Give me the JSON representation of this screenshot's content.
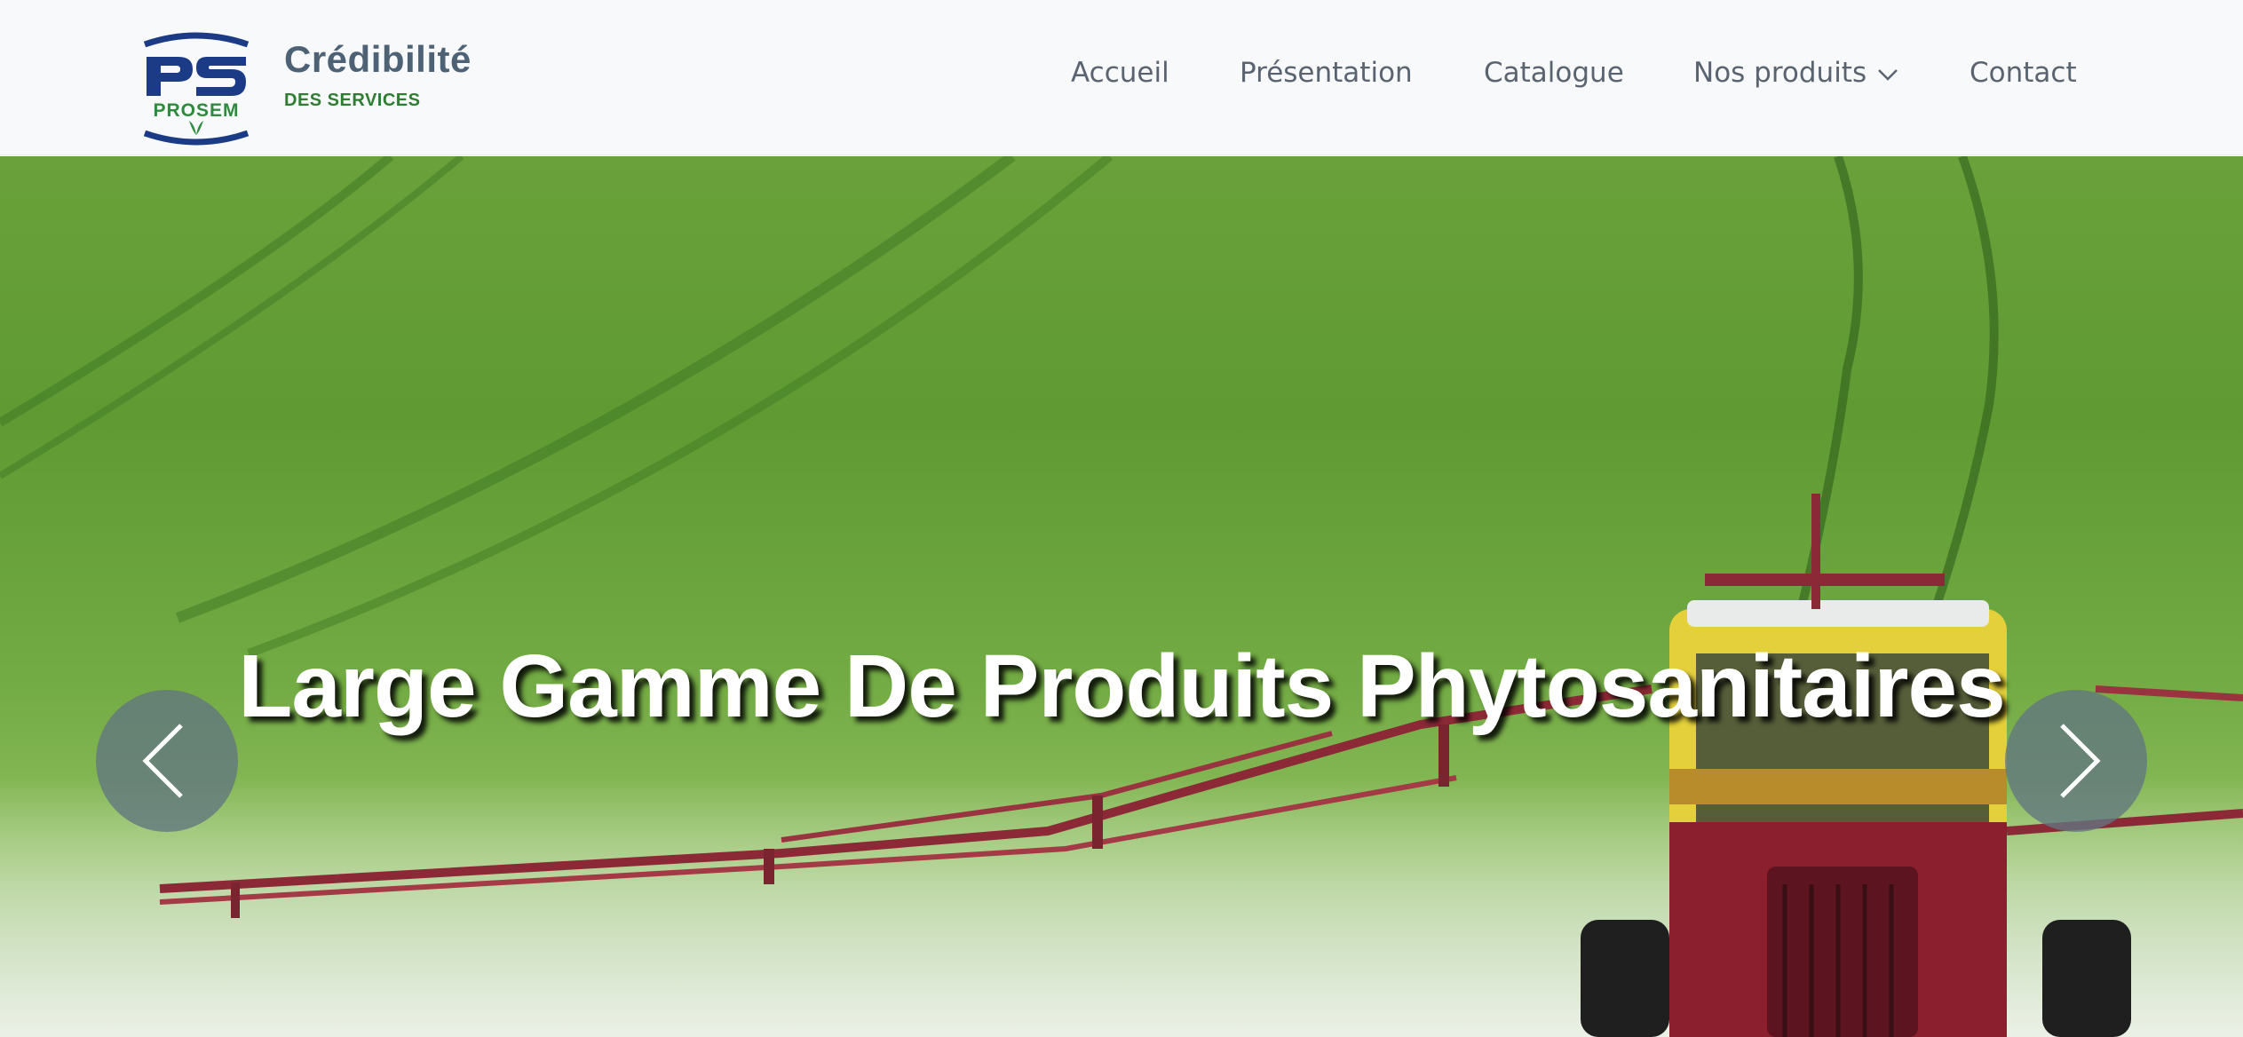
{
  "header": {
    "logo": {
      "icon": "prosem-logo-icon",
      "text": "PROSEM",
      "colors": {
        "navy": "#1c3b87",
        "green": "#2e8b3e"
      }
    },
    "brand_name": "Crédibilité",
    "brand_tagline": "DES SERVICES"
  },
  "nav": {
    "items": [
      {
        "label": "Accueil"
      },
      {
        "label": "Présentation"
      },
      {
        "label": "Catalogue"
      },
      {
        "label": "Nos produits",
        "icon": "chevron-down-icon"
      },
      {
        "label": "Contact"
      }
    ]
  },
  "hero": {
    "title": "Large Gamme De Produits Phytosanitaires",
    "prev_icon": "chevron-left-icon",
    "next_icon": "chevron-right-icon",
    "image": "green-field-tractor-sprayer"
  },
  "colors": {
    "brand_text": "#4d6275",
    "tagline": "#2e7d32",
    "nav_text": "#5a6470",
    "navbar_bg": "#f8f9fb"
  }
}
